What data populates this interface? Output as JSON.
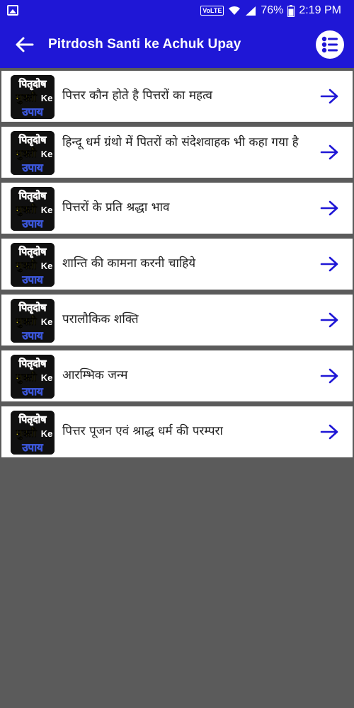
{
  "status_bar": {
    "network_label": "VoLTE",
    "battery_percent": "76%",
    "time": "2:19 PM",
    "icons": [
      "gallery-icon",
      "wifi-icon",
      "signal-icon",
      "battery-icon"
    ]
  },
  "app_bar": {
    "title": "Pitrdosh Santi ke Achuk Upay",
    "back_icon": "arrow-left-icon",
    "menu_icon": "list-menu-icon"
  },
  "list": {
    "items": [
      {
        "label": "पित्तर कौन होते है पित्तरों का महत्व"
      },
      {
        "label": "हिन्दू धर्म ग्रंथो में पितरों को संदेशवाहक भी कहा गया है"
      },
      {
        "label": "पित्तरों के प्रति श्रद्धा भाव"
      },
      {
        "label": "शान्ति की कामना करनी चाहिये"
      },
      {
        "label": "परालौकिक शक्ति"
      },
      {
        "label": "आरम्भिक जन्म"
      },
      {
        "label": "पित्तर पूजन एवं श्राद्ध धर्म की परम्परा"
      }
    ],
    "thumbnail_text": {
      "line1": "पितृदोष",
      "line2": "मुक्ती",
      "line2b": "Ke",
      "line3": "उपाय"
    },
    "item_arrow_icon": "arrow-right-icon"
  },
  "colors": {
    "primary": "#1f17d6",
    "background": "#5b5b5b",
    "card": "#ffffff",
    "arrow": "#1f17d6"
  }
}
